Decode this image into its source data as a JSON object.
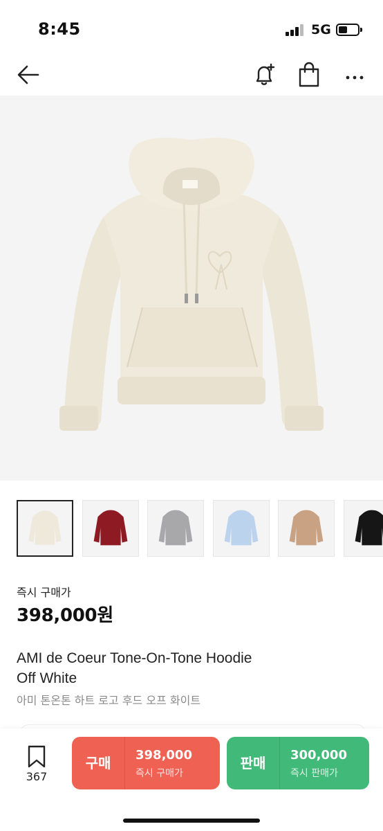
{
  "status_bar": {
    "time": "8:45",
    "network": "5G"
  },
  "header": {
    "back_icon": "arrow-left-icon",
    "alert_icon": "bell-plus-icon",
    "bag_icon": "shopping-bag-icon",
    "more_icon": "more-horizontal-icon"
  },
  "product": {
    "price_label": "즉시 구매가",
    "price": "398,000원",
    "title_en_line1": "AMI de Coeur Tone-On-Tone Hoodie",
    "title_en_line2": "Off White",
    "title_ko": "아미 톤온톤 하트 로고 후드 오프 화이트"
  },
  "colors": {
    "off_white": "#efe9dc",
    "burgundy": "#8e1b24",
    "grey": "#a8a8aa",
    "sky_blue": "#bcd3ee",
    "beige": "#c9a283",
    "black": "#161616",
    "buy": "#ef6253",
    "sell": "#41b979"
  },
  "bottom_bar": {
    "wish_count": "367",
    "buy": {
      "label": "구매",
      "amount": "398,000",
      "sub": "즉시 구매가"
    },
    "sell": {
      "label": "판매",
      "amount": "300,000",
      "sub": "즉시 판매가"
    }
  }
}
